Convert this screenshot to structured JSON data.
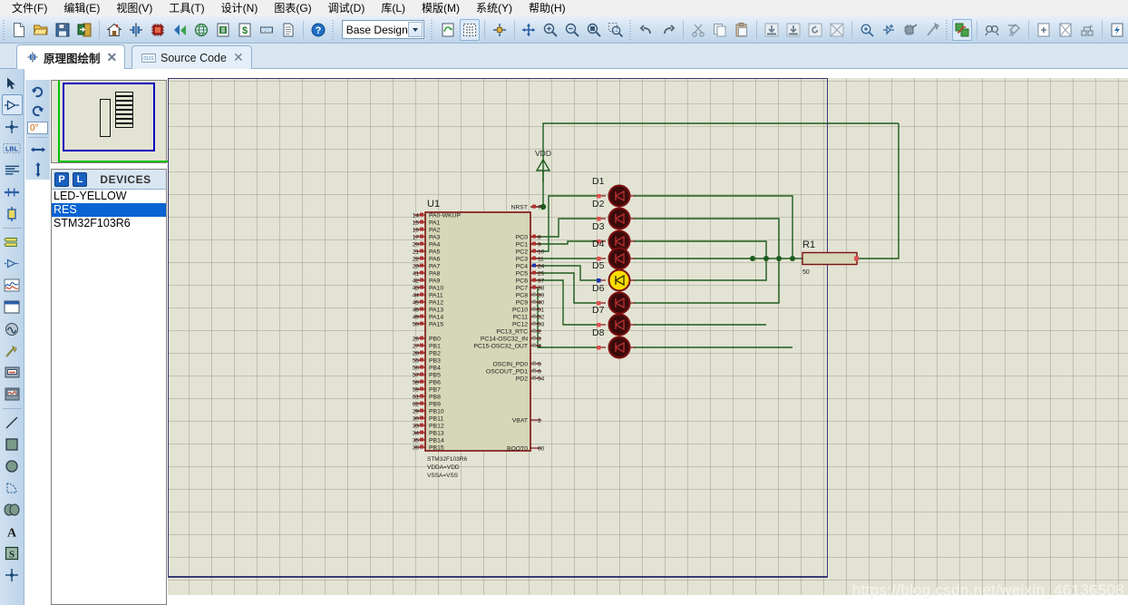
{
  "menu": {
    "items": [
      {
        "label": "文件(F)",
        "name": "menu-file"
      },
      {
        "label": "编辑(E)",
        "name": "menu-edit"
      },
      {
        "label": "视图(V)",
        "name": "menu-view"
      },
      {
        "label": "工具(T)",
        "name": "menu-tools"
      },
      {
        "label": "设计(N)",
        "name": "menu-design"
      },
      {
        "label": "图表(G)",
        "name": "menu-graph"
      },
      {
        "label": "调试(D)",
        "name": "menu-debug"
      },
      {
        "label": "库(L)",
        "name": "menu-library"
      },
      {
        "label": "模版(M)",
        "name": "menu-template"
      },
      {
        "label": "系统(Y)",
        "name": "menu-system"
      },
      {
        "label": "帮助(H)",
        "name": "menu-help"
      }
    ]
  },
  "toolbar": {
    "design_combo_value": "Base Design",
    "buttons": [
      {
        "name": "new-file-icon",
        "tip": "新建"
      },
      {
        "name": "open-file-icon",
        "tip": "打开"
      },
      {
        "name": "save-file-icon",
        "tip": "保存"
      },
      {
        "name": "import-export-icon",
        "tip": "导入导出"
      },
      {
        "name": "home-icon",
        "tip": "主页"
      },
      {
        "name": "schematic-capture-icon",
        "tip": "原理图绘制"
      },
      {
        "name": "pcb-layout-icon",
        "tip": "PCB设计"
      },
      {
        "name": "3d-view-icon",
        "tip": "3D视图"
      },
      {
        "name": "simulation-icon",
        "tip": "仿真"
      },
      {
        "name": "bom-report-icon",
        "tip": "物料清单"
      },
      {
        "name": "bill-cost-icon",
        "tip": "成本"
      },
      {
        "name": "netlist-icon",
        "tip": "网表"
      },
      {
        "name": "report-icon",
        "tip": "报表"
      },
      {
        "name": "help-icon",
        "tip": "帮助"
      },
      {
        "name": "refresh-icon",
        "tip": "刷新"
      },
      {
        "name": "toggle-grid-icon",
        "tip": "栅格"
      },
      {
        "name": "origin-icon",
        "tip": "原点"
      },
      {
        "name": "pan-icon",
        "tip": "平移"
      },
      {
        "name": "zoom-in-icon",
        "tip": "放大"
      },
      {
        "name": "zoom-out-icon",
        "tip": "缩小"
      },
      {
        "name": "zoom-all-icon",
        "tip": "全部"
      },
      {
        "name": "zoom-area-icon",
        "tip": "区域缩放"
      },
      {
        "name": "undo-icon",
        "tip": "撤销"
      },
      {
        "name": "redo-icon",
        "tip": "重做"
      },
      {
        "name": "cut-icon",
        "tip": "剪切"
      },
      {
        "name": "copy-icon",
        "tip": "复制"
      },
      {
        "name": "paste-icon",
        "tip": "粘贴"
      },
      {
        "name": "block-copy-icon",
        "tip": "块复制"
      },
      {
        "name": "block-move-icon",
        "tip": "块移动"
      },
      {
        "name": "block-rotate-icon",
        "tip": "块旋转"
      },
      {
        "name": "block-delete-icon",
        "tip": "块删除"
      },
      {
        "name": "pick-device-icon",
        "tip": "选取元件"
      },
      {
        "name": "make-device-icon",
        "tip": "制作元件"
      },
      {
        "name": "packaging-tool-icon",
        "tip": "封装工具"
      },
      {
        "name": "decompose-icon",
        "tip": "分解"
      },
      {
        "name": "toggle-netlist-icon",
        "tip": "网络表"
      },
      {
        "name": "search-tag-icon",
        "tip": "查找"
      },
      {
        "name": "property-assign-icon",
        "tip": "属性分配"
      },
      {
        "name": "new-sheet-icon",
        "tip": "新建图纸"
      },
      {
        "name": "remove-sheet-icon",
        "tip": "移除图纸"
      },
      {
        "name": "exit-sheet-icon",
        "tip": "退出图纸"
      },
      {
        "name": "design-explorer-icon",
        "tip": "设计浏览器"
      }
    ]
  },
  "tabs": [
    {
      "label": "原理图绘制",
      "icon": "schematic-icon",
      "selected": true
    },
    {
      "label": "Source Code",
      "icon": "source-code-icon",
      "selected": false
    }
  ],
  "rail": {
    "items": [
      {
        "name": "selection-mode",
        "icon": "arrow-pointer-icon",
        "active": false
      },
      {
        "name": "component-mode",
        "icon": "component-icon",
        "active": true
      },
      {
        "name": "junction-dot-mode",
        "icon": "junction-dot-icon",
        "active": false
      },
      {
        "name": "wire-label-mode",
        "icon": "wire-label-icon",
        "active": false
      },
      {
        "name": "text-script-mode",
        "icon": "text-script-icon",
        "active": false
      },
      {
        "name": "buses-mode",
        "icon": "bus-icon",
        "active": false
      },
      {
        "name": "subcircuit-mode",
        "icon": "subcircuit-icon",
        "active": false
      },
      {
        "name": "terminals-mode",
        "icon": "terminal-icon",
        "active": false
      },
      {
        "name": "device-pins-mode",
        "icon": "device-pin-icon",
        "active": false
      },
      {
        "name": "graph-mode",
        "icon": "graph-icon",
        "active": false
      },
      {
        "name": "tape-recorder-mode",
        "icon": "tape-recorder-icon",
        "active": false
      },
      {
        "name": "generator-mode",
        "icon": "generator-icon",
        "active": false
      },
      {
        "name": "voltage-probe-mode",
        "icon": "voltage-probe-icon",
        "active": false
      },
      {
        "name": "current-probe-mode",
        "icon": "current-probe-icon",
        "active": false
      },
      {
        "name": "virtual-instrument-mode",
        "icon": "instrument-icon",
        "active": false
      },
      {
        "name": "line-tool",
        "icon": "line-icon",
        "active": false
      },
      {
        "name": "box-tool",
        "icon": "box-icon",
        "active": false
      },
      {
        "name": "circle-tool",
        "icon": "circle-icon",
        "active": false
      },
      {
        "name": "arc-tool",
        "icon": "arc-icon",
        "active": false
      },
      {
        "name": "path-tool",
        "icon": "path-icon",
        "active": false
      },
      {
        "name": "text-tool",
        "icon": "text-a-icon",
        "active": false
      },
      {
        "name": "symbol-tool",
        "icon": "symbol-s-icon",
        "active": false
      },
      {
        "name": "marker-tool",
        "icon": "marker-icon",
        "active": false
      }
    ]
  },
  "orientation": {
    "rotate_cw": "rotate-cw-icon",
    "rotate_ccw": "rotate-ccw-icon",
    "angle_value": "0°",
    "mirror_x": "mirror-horizontal-icon",
    "mirror_y": "mirror-vertical-icon"
  },
  "devices": {
    "p_button": "P",
    "l_button": "L",
    "title": "DEVICES",
    "items": [
      {
        "label": "LED-YELLOW",
        "selected": false
      },
      {
        "label": "RES",
        "selected": true
      },
      {
        "label": "STM32F103R6",
        "selected": false
      }
    ]
  },
  "schematic": {
    "watermark": "https://blog.csdn.net/weixin_46136508",
    "chip": {
      "ref": "U1",
      "footer": [
        "STM32F103R6",
        "VDDA=VDD",
        "VSSA=VSS"
      ],
      "left_pins": [
        {
          "num": "14",
          "name": "PA0-WKUP"
        },
        {
          "num": "15",
          "name": "PA1"
        },
        {
          "num": "16",
          "name": "PA2"
        },
        {
          "num": "17",
          "name": "PA3"
        },
        {
          "num": "20",
          "name": "PA4"
        },
        {
          "num": "21",
          "name": "PA5"
        },
        {
          "num": "22",
          "name": "PA6"
        },
        {
          "num": "23",
          "name": "PA7"
        },
        {
          "num": "41",
          "name": "PA8"
        },
        {
          "num": "42",
          "name": "PA9"
        },
        {
          "num": "43",
          "name": "PA10"
        },
        {
          "num": "44",
          "name": "PA11"
        },
        {
          "num": "45",
          "name": "PA12"
        },
        {
          "num": "46",
          "name": "PA13"
        },
        {
          "num": "49",
          "name": "PA14"
        },
        {
          "num": "50",
          "name": "PA15"
        },
        {
          "num": "26",
          "name": "PB0"
        },
        {
          "num": "27",
          "name": "PB1"
        },
        {
          "num": "28",
          "name": "PB2"
        },
        {
          "num": "55",
          "name": "PB3"
        },
        {
          "num": "56",
          "name": "PB4"
        },
        {
          "num": "57",
          "name": "PB5"
        },
        {
          "num": "58",
          "name": "PB6"
        },
        {
          "num": "59",
          "name": "PB7"
        },
        {
          "num": "61",
          "name": "PB8"
        },
        {
          "num": "62",
          "name": "PB9"
        },
        {
          "num": "29",
          "name": "PB10"
        },
        {
          "num": "30",
          "name": "PB11"
        },
        {
          "num": "33",
          "name": "PB12"
        },
        {
          "num": "34",
          "name": "PB13"
        },
        {
          "num": "35",
          "name": "PB14"
        },
        {
          "num": "36",
          "name": "PB15"
        }
      ],
      "right_pins": [
        {
          "num": "7",
          "name": "NRST"
        },
        {
          "num": "8",
          "name": "PC0"
        },
        {
          "num": "9",
          "name": "PC1"
        },
        {
          "num": "10",
          "name": "PC2"
        },
        {
          "num": "11",
          "name": "PC3"
        },
        {
          "num": "24",
          "name": "PC4"
        },
        {
          "num": "25",
          "name": "PC5"
        },
        {
          "num": "37",
          "name": "PC6"
        },
        {
          "num": "38",
          "name": "PC7"
        },
        {
          "num": "39",
          "name": "PC8"
        },
        {
          "num": "40",
          "name": "PC9"
        },
        {
          "num": "51",
          "name": "PC10"
        },
        {
          "num": "52",
          "name": "PC11"
        },
        {
          "num": "53",
          "name": "PC12"
        },
        {
          "num": "2",
          "name": "PC13_RTC"
        },
        {
          "num": "3",
          "name": "PC14-OSC32_IN"
        },
        {
          "num": "4",
          "name": "PC15-OSC32_OUT"
        },
        {
          "num": "5",
          "name": "OSCIN_PD0"
        },
        {
          "num": "6",
          "name": "OSCOUT_PD1"
        },
        {
          "num": "54",
          "name": "PD2"
        },
        {
          "num": "1",
          "name": "VBAT"
        },
        {
          "num": "60",
          "name": "BOOT0"
        }
      ]
    },
    "power": {
      "label": "VDD"
    },
    "leds": [
      {
        "ref": "D1",
        "color": "#3a0b0b",
        "on": false
      },
      {
        "ref": "D2",
        "color": "#3a0b0b",
        "on": false
      },
      {
        "ref": "D3",
        "color": "#3a0b0b",
        "on": false
      },
      {
        "ref": "D4",
        "color": "#3a0b0b",
        "on": false
      },
      {
        "ref": "D5",
        "color": "#ffdd00",
        "on": true
      },
      {
        "ref": "D6",
        "color": "#3a0b0b",
        "on": false
      },
      {
        "ref": "D7",
        "color": "#3a0b0b",
        "on": false
      },
      {
        "ref": "D8",
        "color": "#3a0b0b",
        "on": false
      }
    ],
    "resistor": {
      "ref": "R1",
      "value": "50"
    }
  },
  "colors": {
    "wire": "#1d5c1d",
    "chip_fill": "#d6d6b8",
    "chip_border": "#7a1010",
    "pin_red": "#b03030",
    "pin_blue": "#2030b0",
    "sheet_bg": "#e3e3d4",
    "accent_blue": "#0a64d2"
  }
}
